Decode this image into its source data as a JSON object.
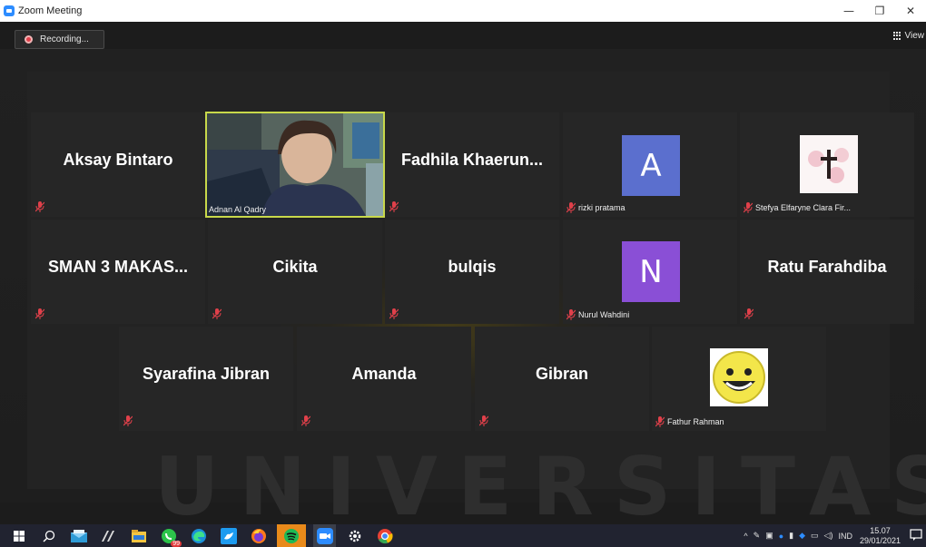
{
  "window": {
    "title": "Zoom Meeting",
    "minimize": "—",
    "restore": "❐",
    "close": "✕"
  },
  "toolbar": {
    "recording_label": "Recording...",
    "view_label": "View"
  },
  "watermark": "UNIVERSITAS",
  "participants": [
    {
      "name": "Aksay Bintaro",
      "muted": true
    },
    {
      "name": "Adnan Al Qadry",
      "video": true
    },
    {
      "name": "Fadhila Khaerun...",
      "muted": true
    },
    {
      "name": "rizki pratama",
      "avatar_letter": "A",
      "avatar_color": "#5b6fce",
      "muted": true
    },
    {
      "name": "Stefya Elfaryne Clara Fir...",
      "avatar_image": "cross-flower-icon",
      "muted": true
    },
    {
      "name": "SMAN 3 MAKAS...",
      "muted": true
    },
    {
      "name": "Cikita",
      "muted": true
    },
    {
      "name": "bulqis",
      "muted": true
    },
    {
      "name": "Nurul Wahdini",
      "avatar_letter": "N",
      "avatar_color": "#8a4fd6",
      "muted": true
    },
    {
      "name": "Ratu Farahdiba",
      "muted": true
    },
    {
      "name": "Syarafina Jibran",
      "muted": true
    },
    {
      "name": "Amanda",
      "muted": true
    },
    {
      "name": "Gibran",
      "muted": true
    },
    {
      "name": "Fathur Rahman",
      "avatar_image": "smiley-face-icon",
      "muted": true
    }
  ],
  "taskbar": {
    "apps": [
      "windows-start-icon",
      "search-icon",
      "mail-icon",
      "pen-app-icon",
      "file-explorer-icon",
      "whatsapp-icon",
      "edge-icon",
      "twitter-icon",
      "firefox-icon",
      "spotify-icon",
      "zoom-icon",
      "settings-icon",
      "chrome-icon"
    ],
    "whatsapp_badge": "99",
    "language": "IND",
    "time": "15.07",
    "date": "29/01/2021"
  },
  "colors": {
    "accent_video_border": "#c8d84a",
    "muted_red": "#e0404a",
    "taskbar": "#212330"
  }
}
